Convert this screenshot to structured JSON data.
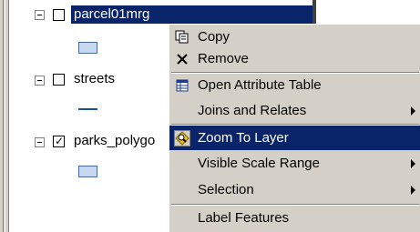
{
  "toc": {
    "layers": [
      {
        "name": "parcel01mrg",
        "checked": false,
        "selected": true,
        "symbol": "polygon"
      },
      {
        "name": "streets",
        "checked": false,
        "selected": false,
        "symbol": "line"
      },
      {
        "name": "parks_polygo",
        "checked": true,
        "selected": false,
        "symbol": "polygon"
      }
    ]
  },
  "context_menu": {
    "items": [
      {
        "label": "Copy",
        "icon": "copy-icon",
        "submenu": false,
        "highlighted": false
      },
      {
        "label": "Remove",
        "icon": "remove-x-icon",
        "submenu": false,
        "highlighted": false
      },
      {
        "label": "Open Attribute Table",
        "icon": "table-icon",
        "submenu": false,
        "highlighted": false
      },
      {
        "label": "Joins and Relates",
        "icon": "",
        "submenu": true,
        "highlighted": false
      },
      {
        "label": "Zoom To Layer",
        "icon": "zoom-to-layer-icon",
        "submenu": false,
        "highlighted": true
      },
      {
        "label": "Visible Scale Range",
        "icon": "",
        "submenu": true,
        "highlighted": false
      },
      {
        "label": "Selection",
        "icon": "",
        "submenu": true,
        "highlighted": false
      },
      {
        "label": "Label Features",
        "icon": "",
        "submenu": false,
        "highlighted": false
      }
    ]
  },
  "colors": {
    "selection": "#0a246a",
    "menu_bg": "#d4d0c8",
    "polygon_fill": "#c8d8f0",
    "line_symbol": "#1e4fa6"
  }
}
